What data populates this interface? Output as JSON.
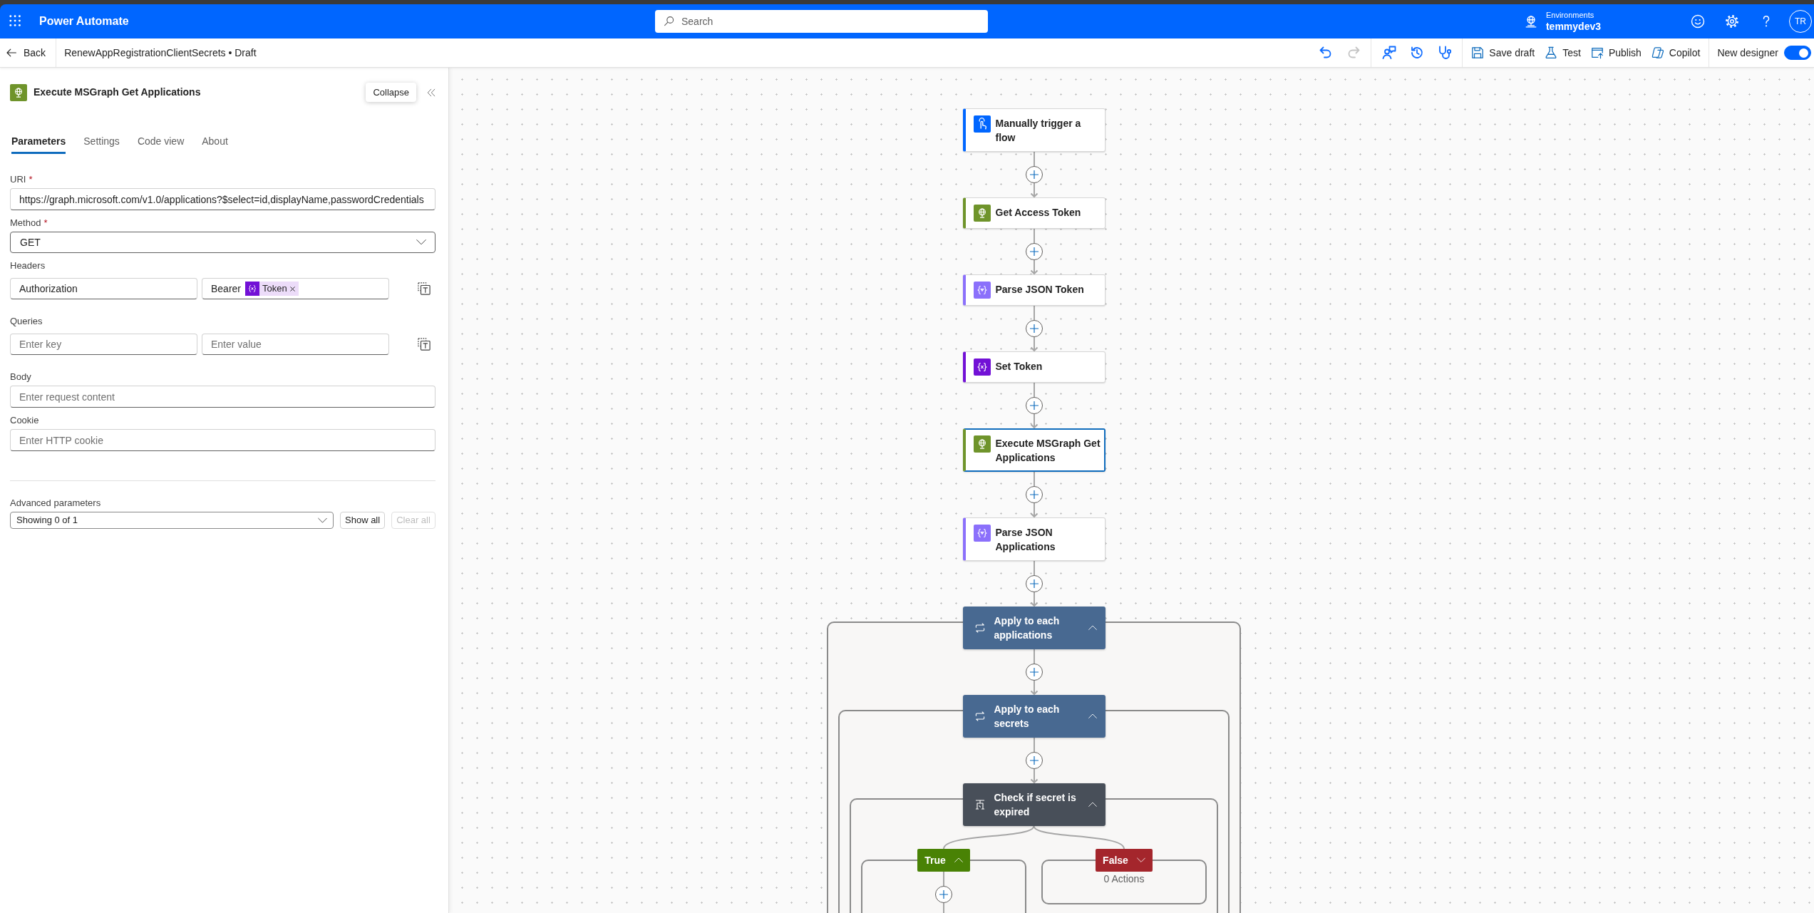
{
  "app_bar": {
    "title": "Power Automate",
    "search": {
      "placeholder": "Search"
    },
    "environment": {
      "label": "Environments",
      "name": "temmydev3"
    },
    "avatar": "TR"
  },
  "command_bar": {
    "back": "Back",
    "flow_title": "RenewAppRegistrationClientSecrets • Draft",
    "icon_groups": [
      [
        {
          "kind": "undo",
          "disabled": false
        },
        {
          "kind": "redo",
          "disabled": true
        }
      ],
      [
        {
          "kind": "comments",
          "disabled": false
        },
        {
          "kind": "history",
          "disabled": false
        },
        {
          "kind": "checker",
          "disabled": false
        }
      ]
    ],
    "buttons": [
      {
        "kind": "save",
        "label": "Save draft"
      },
      {
        "kind": "test",
        "label": "Test"
      },
      {
        "kind": "publish",
        "label": "Publish"
      },
      {
        "kind": "copilot",
        "label": "Copilot"
      }
    ],
    "new_designer": {
      "label": "New designer",
      "on": true
    }
  },
  "panel": {
    "kind": "http",
    "title": "Execute MSGraph Get Applications",
    "tooltip": "Collapse",
    "tabs": [
      {
        "label": "Parameters",
        "selected": true
      },
      {
        "label": "Settings",
        "selected": false
      },
      {
        "label": "Code view",
        "selected": false
      },
      {
        "label": "About",
        "selected": false
      }
    ],
    "fields": [
      {
        "kind": "text",
        "label": "URI",
        "required_mark": "*",
        "value": "https://graph.microsoft.com/v1.0/applications?$select=id,displayName,passwordCredentials"
      },
      {
        "kind": "select",
        "label": "Method",
        "required_mark": "*",
        "value": "GET"
      },
      {
        "kind": "pairs",
        "label": "Headers",
        "key": {
          "value": "Authorization"
        },
        "value": {
          "text": "Bearer",
          "token": "Token"
        }
      },
      {
        "kind": "pairs",
        "label": "Queries",
        "key": {
          "placeholder": "Enter key"
        },
        "value": {
          "placeholder": "Enter value"
        }
      },
      {
        "kind": "text",
        "label": "Body",
        "placeholder": "Enter request content"
      },
      {
        "kind": "text",
        "label": "Cookie",
        "placeholder": "Enter HTTP cookie"
      }
    ],
    "advanced": {
      "label": "Advanced parameters",
      "value": "Showing 0 of 1",
      "buttons": [
        {
          "label": "Show all",
          "disabled": false
        },
        {
          "label": "Clear all",
          "disabled": true
        }
      ]
    }
  },
  "flow": [
    {
      "kind": "trigger",
      "title": "Manually trigger a flow",
      "selected": false
    },
    {
      "kind": "http",
      "title": "Get Access Token",
      "selected": false
    },
    {
      "kind": "parse_json",
      "title": "Parse JSON Token",
      "selected": false
    },
    {
      "kind": "variable",
      "title": "Set Token",
      "selected": false
    },
    {
      "kind": "http",
      "title": "Execute MSGraph Get Applications",
      "selected": true
    },
    {
      "kind": "parse_json",
      "title": "Parse JSON Applications",
      "selected": false
    },
    {
      "kind": "foreach",
      "title": "Apply to each applications",
      "selected": false,
      "expanded": true,
      "children": [
        {
          "kind": "foreach",
          "title": "Apply to each secrets",
          "selected": false,
          "expanded": true,
          "children": [
            {
              "kind": "condition",
              "title": "Check if secret is expired",
              "selected": false,
              "expanded": true,
              "branches": [
                {
                  "kind": "true",
                  "label": "True",
                  "expanded": true
                },
                {
                  "kind": "false",
                  "label": "False",
                  "expanded": false,
                  "summary": "0 Actions"
                }
              ]
            }
          ]
        }
      ]
    }
  ]
}
